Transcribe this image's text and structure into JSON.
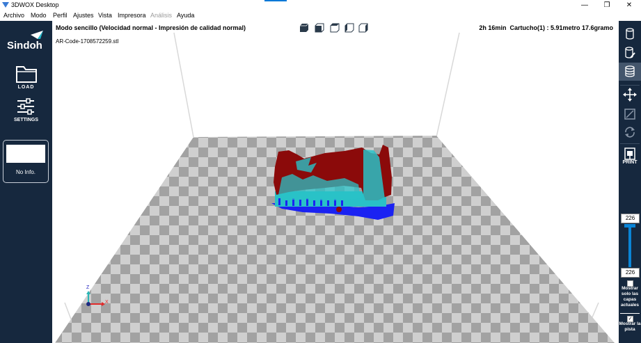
{
  "window": {
    "title": "3DWOX Desktop",
    "minimize": "—",
    "restore": "❐",
    "close": "✕"
  },
  "menu": [
    {
      "label": "Archivo",
      "disabled": false
    },
    {
      "label": "Modo",
      "disabled": false
    },
    {
      "label": "Perfil",
      "disabled": false
    },
    {
      "label": "Ajustes",
      "disabled": false
    },
    {
      "label": "Vista",
      "disabled": false
    },
    {
      "label": "Impresora",
      "disabled": false
    },
    {
      "label": "Análisis",
      "disabled": true
    },
    {
      "label": "Ayuda",
      "disabled": false
    }
  ],
  "sidebar": {
    "brand": "Sindoh",
    "load_label": "LOAD",
    "settings_label": "SETTINGS",
    "info_text": "No Info."
  },
  "viewport": {
    "mode_text": "Modo sencillo (Velocidad normal - Impresión de calidad normal)",
    "filename": "AR-Code-1708572259.stl",
    "time": "2h 16min",
    "cartridge": "Cartucho(1) : 5.91metro 17.6gramo",
    "axis_z": "Z",
    "axis_x": "X"
  },
  "rightbar": {
    "print_label": "PRINT",
    "layer_top": "226",
    "layer_bottom": "226",
    "layer_fill": 1.0,
    "show_current_layers": "Mostrar solo las capas actuales",
    "show_current_layers_checked": false,
    "show_track": "Mostrar la pista",
    "show_track_checked": true
  },
  "colors": {
    "panel": "#16283e",
    "model": "#8b0a0a",
    "support": "#29c1c7",
    "raft": "#1a22f2",
    "grid_light": "#cfcfcf",
    "grid_dark": "#a2a2a2"
  }
}
